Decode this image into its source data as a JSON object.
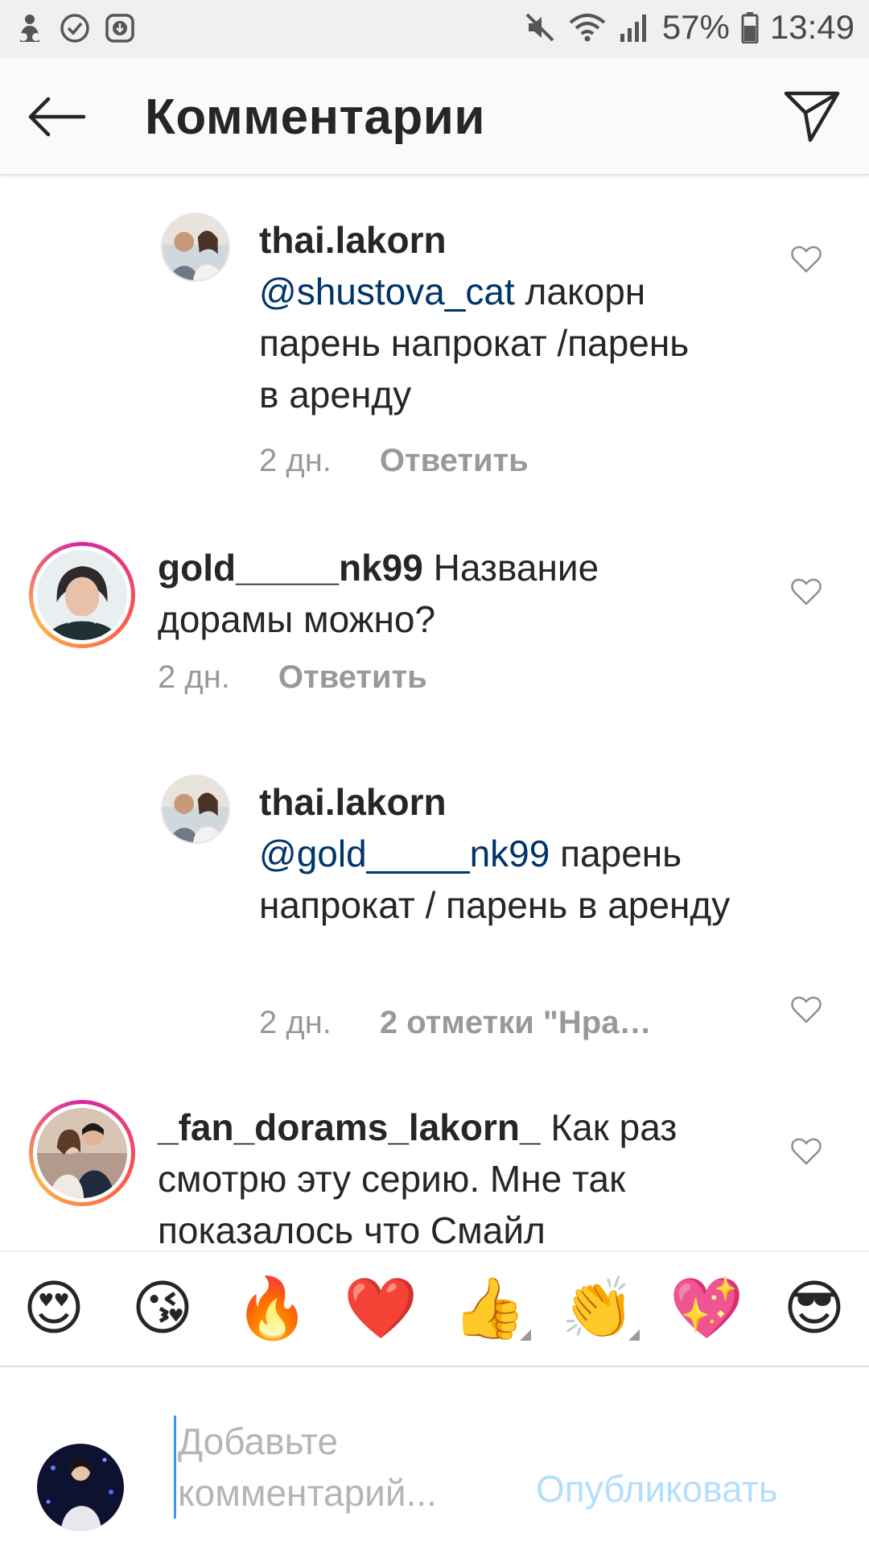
{
  "status_bar": {
    "battery": "57%",
    "time": "13:49",
    "icons": [
      "app-notification-icon",
      "check-circle-icon",
      "download-icon",
      "mute-icon",
      "wifi-icon",
      "signal-icon",
      "battery-icon"
    ]
  },
  "header": {
    "title": "Комментарии",
    "icons": [
      "back-arrow-icon",
      "direct-send-icon"
    ]
  },
  "comments": [
    {
      "username": "thai.lakorn",
      "mention": "@shustova_cat",
      "text": " лакорн парень напрокат /парень в аренду",
      "time": "2 дн.",
      "action": "Ответить",
      "is_reply": true
    },
    {
      "username": "gold_____nk99",
      "mention": "",
      "text": " Название дорамы можно?",
      "time": "2 дн.",
      "action": "Ответить",
      "is_reply": false
    },
    {
      "username": "thai.lakorn",
      "mention": "@gold_____nk99",
      "text": " парень напрокат / парень в аренду",
      "time": "2 дн.",
      "action": "2 отметки \"Нра…",
      "is_reply": true
    },
    {
      "username": "_fan_dorams_lakorn_",
      "mention": "",
      "text": " Как раз смотрю эту серию. Мне так показалось что Смайл",
      "is_reply": false
    }
  ],
  "emoji_bar": [
    "😍",
    "😘",
    "🔥",
    "❤️",
    "👍",
    "👏",
    "💖",
    "😎"
  ],
  "composer": {
    "placeholder": "Добавьте комментарий...",
    "publish_label": "Опубликовать"
  },
  "colors": {
    "mention": "#003569",
    "meta": "#999999",
    "publish_disabled": "#b2dffc",
    "header_bg": "#fafafa",
    "status_bg": "#f0f0f0"
  }
}
